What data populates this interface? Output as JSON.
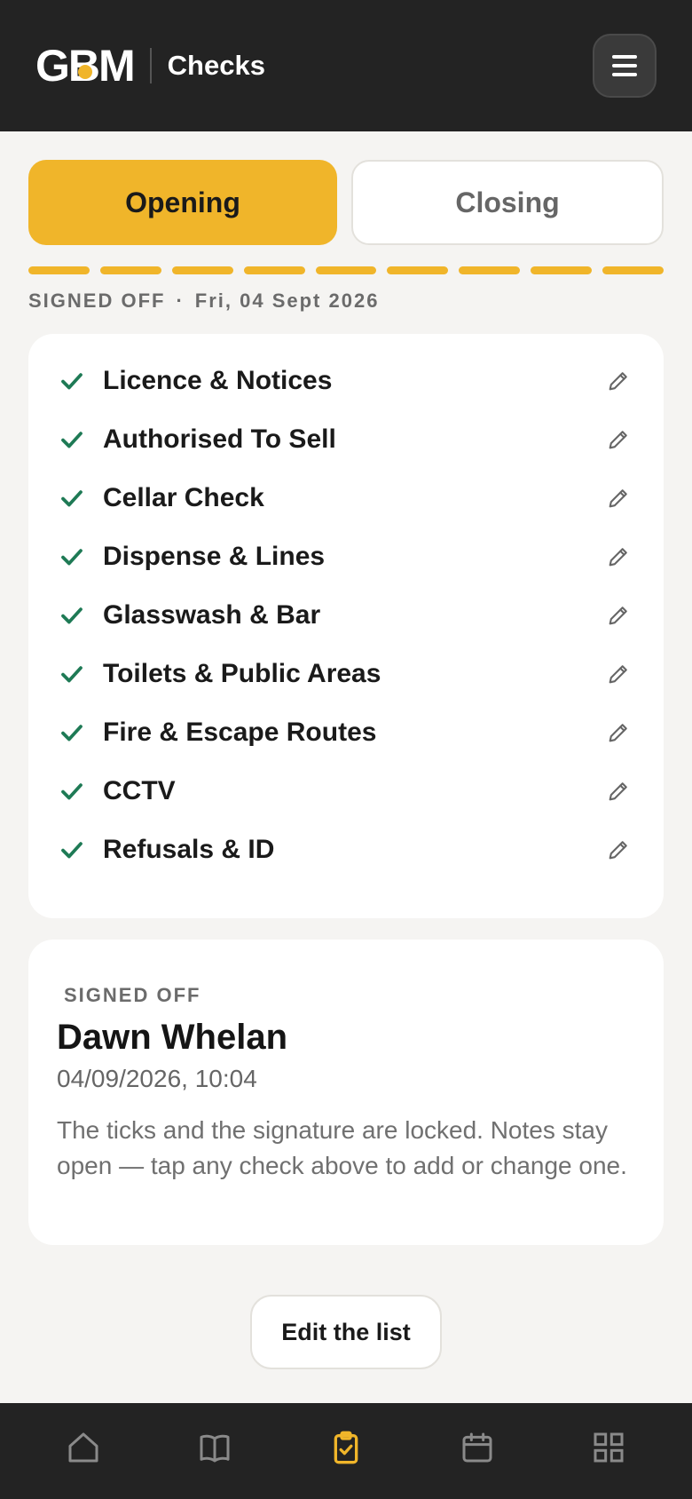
{
  "header": {
    "logo_text": "GBM",
    "app_name": "Checks",
    "menu_icon": "hamburger-menu-icon"
  },
  "tabs": [
    {
      "label": "Opening",
      "active": true
    },
    {
      "label": "Closing",
      "active": false
    }
  ],
  "progress": {
    "segments_total": 9,
    "segments_complete": 9
  },
  "status": {
    "state": "SIGNED OFF",
    "separator": "·",
    "date": "Fri, 04 Sept 2026"
  },
  "checks": [
    {
      "label": "Licence & Notices",
      "done": true
    },
    {
      "label": "Authorised To Sell",
      "done": true
    },
    {
      "label": "Cellar Check",
      "done": true
    },
    {
      "label": "Dispense & Lines",
      "done": true
    },
    {
      "label": "Glasswash & Bar",
      "done": true
    },
    {
      "label": "Toilets & Public Areas",
      "done": true
    },
    {
      "label": "Fire & Escape Routes",
      "done": true
    },
    {
      "label": "CCTV",
      "done": true
    },
    {
      "label": "Refusals & ID",
      "done": true
    }
  ],
  "signoff": {
    "label": "SIGNED OFF",
    "name": "Dawn Whelan",
    "timestamp": "04/09/2026, 10:04",
    "note": "The ticks and the signature are locked. Notes stay open — tap any check above to add or change one."
  },
  "edit_list_label": "Edit the list",
  "bottom_nav": [
    {
      "icon": "home-icon",
      "active": false
    },
    {
      "icon": "book-icon",
      "active": false
    },
    {
      "icon": "clipboard-check-icon",
      "active": true
    },
    {
      "icon": "calendar-icon",
      "active": false
    },
    {
      "icon": "grid-icon",
      "active": false
    }
  ],
  "colors": {
    "accent": "#f0b52a",
    "check_green": "#1e7a55",
    "header_bg": "#232323"
  }
}
